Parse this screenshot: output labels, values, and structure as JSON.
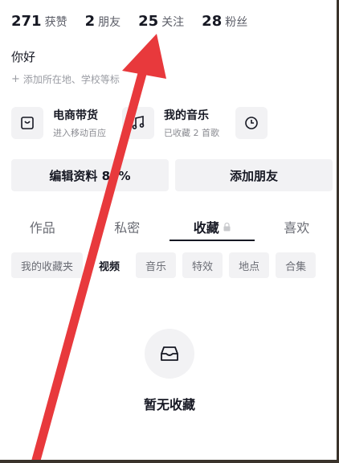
{
  "stats": [
    {
      "num": "271",
      "label": "获赞"
    },
    {
      "num": "2",
      "label": "朋友"
    },
    {
      "num": "25",
      "label": "关注"
    },
    {
      "num": "28",
      "label": "粉丝"
    }
  ],
  "profile": {
    "bio": "你好",
    "add_location": "添加所在地、学校等标"
  },
  "services": [
    {
      "title": "电商带货",
      "subtitle": "进入移动百应",
      "icon": "shopping-bag-icon"
    },
    {
      "title": "我的音乐",
      "subtitle": "已收藏 2 首歌",
      "icon": "music-note-icon"
    },
    {
      "title": "",
      "subtitle": "",
      "icon": "clock-icon"
    }
  ],
  "buttons": {
    "edit_profile": "编辑资料 86%",
    "add_friends": "添加朋友"
  },
  "tabs": [
    {
      "label": "作品"
    },
    {
      "label": "私密"
    },
    {
      "label": "收藏"
    },
    {
      "label": "喜欢"
    }
  ],
  "chips": [
    "我的收藏夹",
    "视频",
    "音乐",
    "特效",
    "地点",
    "合集"
  ],
  "empty_state": {
    "text": "暂无收藏",
    "icon": "inbox-icon"
  },
  "colors": {
    "annotation_arrow": "#e8393c"
  }
}
